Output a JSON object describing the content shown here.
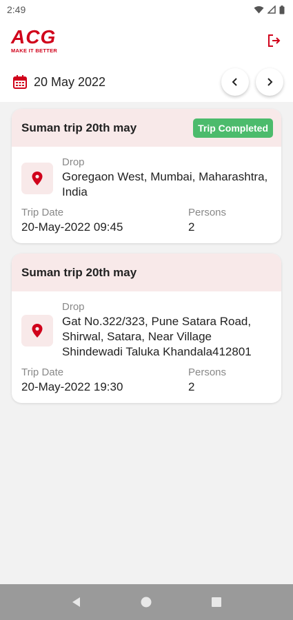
{
  "status_bar": {
    "time": "2:49"
  },
  "header": {
    "logo_text": "ACG",
    "logo_tagline": "MAKE IT BETTER"
  },
  "date_bar": {
    "date": "20 May 2022"
  },
  "trips": [
    {
      "title": "Suman trip 20th may",
      "status": "Trip Completed",
      "drop_label": "Drop",
      "drop_address": "Goregaon West, Mumbai, Maharashtra, India",
      "trip_date_label": "Trip Date",
      "trip_date": "20-May-2022 09:45",
      "persons_label": "Persons",
      "persons": "2"
    },
    {
      "title": "Suman trip 20th may",
      "status": "",
      "drop_label": "Drop",
      "drop_address": "Gat No.322/323, Pune Satara Road, Shirwal, Satara, Near Village Shindewadi Taluka Khandala412801",
      "trip_date_label": "Trip Date",
      "trip_date": "20-May-2022 19:30",
      "persons_label": "Persons",
      "persons": "2"
    }
  ],
  "colors": {
    "brand": "#d0021b",
    "completed_badge": "#4cbb6c",
    "card_header": "#f8e9e9"
  },
  "icons": {
    "logout": "logout-icon",
    "calendar": "calendar-icon",
    "prev": "chevron-left-icon",
    "next": "chevron-right-icon",
    "pin": "location-pin-icon"
  }
}
